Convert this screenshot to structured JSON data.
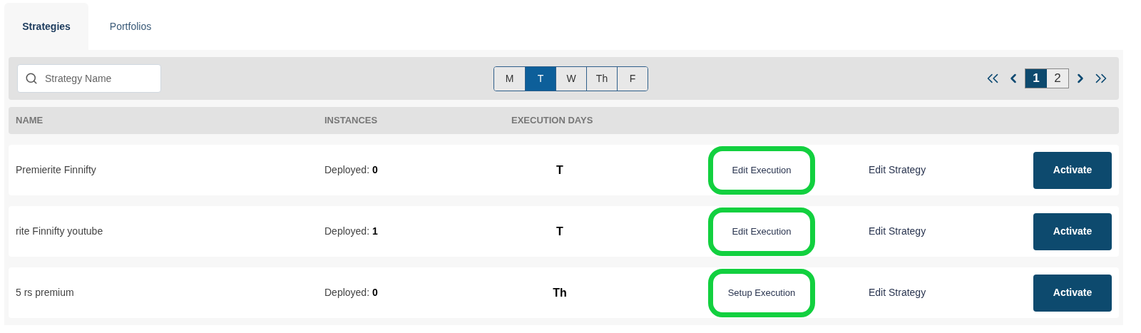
{
  "tabs": [
    {
      "label": "Strategies",
      "selected": true
    },
    {
      "label": "Portfolios",
      "selected": false
    }
  ],
  "search": {
    "placeholder": "Strategy Name"
  },
  "day_filter": [
    {
      "label": "M",
      "selected": false
    },
    {
      "label": "T",
      "selected": true
    },
    {
      "label": "W",
      "selected": false
    },
    {
      "label": "Th",
      "selected": false
    },
    {
      "label": "F",
      "selected": false
    }
  ],
  "pagination": {
    "pages": [
      {
        "label": "1",
        "selected": true
      },
      {
        "label": "2",
        "selected": false
      }
    ]
  },
  "table": {
    "columns": [
      "NAME",
      "INSTANCES",
      "EXECUTION DAYS"
    ],
    "rows": [
      {
        "name": "Premierite Finnifty",
        "deployed_label": "Deployed:",
        "deployed": "0",
        "days": "T",
        "execution_action": "Edit Execution",
        "highlighted": true,
        "strategy_action": "Edit Strategy",
        "activate": "Activate"
      },
      {
        "name": "rite Finnifty youtube",
        "deployed_label": "Deployed:",
        "deployed": "1",
        "days": "T",
        "execution_action": "Edit Execution",
        "highlighted": true,
        "strategy_action": "Edit Strategy",
        "activate": "Activate"
      },
      {
        "name": "5 rs premium",
        "deployed_label": "Deployed:",
        "deployed": "0",
        "days": "Th",
        "execution_action": "Setup Execution",
        "highlighted": true,
        "strategy_action": "Edit Strategy",
        "activate": "Activate"
      }
    ]
  }
}
